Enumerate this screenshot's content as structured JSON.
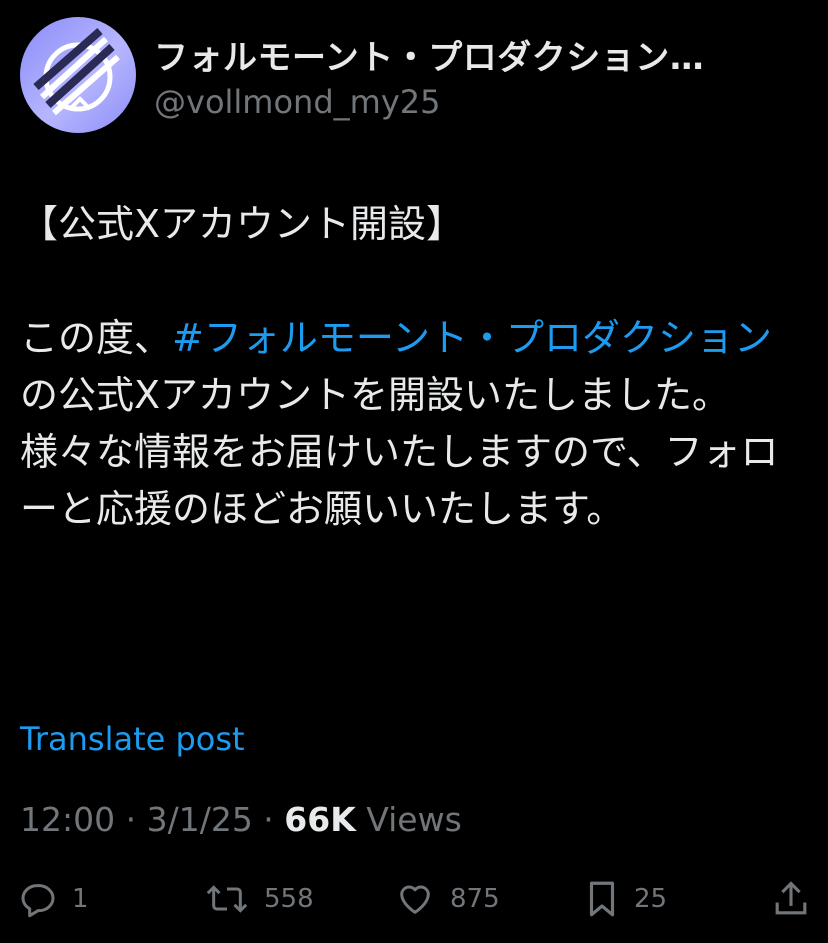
{
  "author": {
    "display_name": "フォルモーント・プロダクション…",
    "handle": "@vollmond_my25"
  },
  "post": {
    "line1": "【公式Xアカウント開設】",
    "p1_prefix": "この度、",
    "hashtag": "#フォルモーント・プロダクション",
    "p1_suffix": " の公式Xアカウントを開設いたしました。",
    "p2": "様々な情報をお届けいたしますので、フォローと応援のほどお願いいたします。"
  },
  "translate_label": "Translate post",
  "meta": {
    "time": "12:00",
    "sep1": " · ",
    "date": "3/1/25",
    "sep2": " · ",
    "views_count": "66K",
    "views_label": " Views"
  },
  "actions": {
    "replies": "1",
    "reposts": "558",
    "likes": "875",
    "bookmarks": "25"
  },
  "colors": {
    "background": "#000000",
    "text": "#e7e9ea",
    "muted": "#71767b",
    "link": "#1d9bf0",
    "avatar": "#9a9bf9"
  }
}
